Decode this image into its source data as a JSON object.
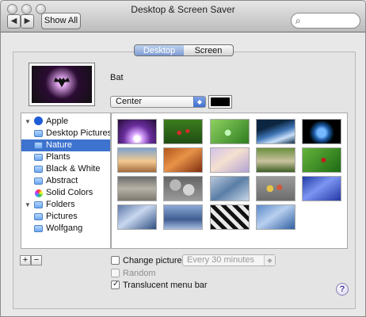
{
  "window": {
    "title": "Desktop & Screen Saver"
  },
  "toolbar": {
    "show_all_label": "Show All",
    "back_glyph": "◀",
    "forward_glyph": "▶",
    "search_placeholder": ""
  },
  "tabs": [
    {
      "label": "Desktop",
      "selected": true
    },
    {
      "label": "Screen Saver",
      "selected": false
    }
  ],
  "preview": {
    "wallpaper_name": "Bat"
  },
  "position_select": {
    "value": "Center"
  },
  "sidebar": {
    "items": [
      {
        "label": "Apple",
        "type": "group",
        "expanded": true
      },
      {
        "label": "Desktop Pictures",
        "type": "folder"
      },
      {
        "label": "Nature",
        "type": "folder",
        "selected": true
      },
      {
        "label": "Plants",
        "type": "folder"
      },
      {
        "label": "Black & White",
        "type": "folder"
      },
      {
        "label": "Abstract",
        "type": "folder"
      },
      {
        "label": "Solid Colors",
        "type": "solid"
      },
      {
        "label": "Folders",
        "type": "group",
        "expanded": true
      },
      {
        "label": "Pictures",
        "type": "folder"
      },
      {
        "label": "Wolfgang",
        "type": "folder"
      }
    ]
  },
  "thumbnails": [
    {
      "name": "purple-burst",
      "bg": "radial-gradient(circle at 50% 80%, #fff 0 10%, #d9a6ff 20%, #6a2e9d 50%, #220c35 100%)"
    },
    {
      "name": "ladybugs",
      "bg": "radial-gradient(circle at 40% 55%, #d52b2b 0 8%, transparent 9%), radial-gradient(circle at 62% 48%, #d52b2b 0 7%, transparent 8%), linear-gradient(#3d7d1f, #1f4d12)"
    },
    {
      "name": "dew-drop",
      "bg": "radial-gradient(circle at 45% 55%, #bff8b7 0 12%, transparent 13%), linear-gradient(135deg, #8ed160, #2f7d21)"
    },
    {
      "name": "wave-blue",
      "bg": "linear-gradient(160deg, #0c2540 0 30%, #3f75b5 55%, #c8dff8 75%, #0e2b49 100%)"
    },
    {
      "name": "earth",
      "bg": "radial-gradient(circle at 50% 55%, #75b8ff 0 18%, #1f5ca8 32%, #082846 45%, #000 55%)"
    },
    {
      "name": "sunset-clouds",
      "bg": "linear-gradient(#7da3d1, #f3c98f 55%, #a16b3d)"
    },
    {
      "name": "orange-dunes",
      "bg": "linear-gradient(145deg, #b4551d, #e89348 45%, #7e2d10)"
    },
    {
      "name": "pastel-sand",
      "bg": "linear-gradient(145deg, #d2c1e9, #f5e0d0 45%, #b4a3d5)"
    },
    {
      "name": "lake-trees",
      "bg": "linear-gradient(#6a8f3d, #c9c39f 55%, #3e5f24)"
    },
    {
      "name": "ladybug-leaf",
      "bg": "radial-gradient(circle at 55% 50%, #c31a1a 0 9%, transparent 10%), linear-gradient(135deg, #64b33b, #1d6b13)"
    },
    {
      "name": "zen-sand",
      "bg": "linear-gradient(#6c6c6c, #b6b2a6 50%, #7d786e)"
    },
    {
      "name": "pebbles",
      "bg": "radial-gradient(circle at 30% 35%, #b7b7b7 0 18%, transparent 19%), radial-gradient(circle at 65% 55%, #d5d5d5 0 20%, transparent 21%), linear-gradient(#646464, #9a9a9a)"
    },
    {
      "name": "water-ripple",
      "bg": "linear-gradient(145deg, #b8c8dc, #5a7ea6 50%, #c7d7e8)"
    },
    {
      "name": "colored-stones",
      "bg": "radial-gradient(circle at 35% 50%, #e6c44a 0 12%, transparent 13%), radial-gradient(circle at 60% 45%, #d1583a 0 10%, transparent 11%), linear-gradient(#9b9b9b, #6b6b6b)"
    },
    {
      "name": "blue-silk",
      "bg": "linear-gradient(145deg, #1f3aa5, #7c95f2 45%, #2438a6)"
    },
    {
      "name": "blue-ice",
      "bg": "linear-gradient(145deg, #5f79a9, #c8d7ef 45%, #2f4f81)"
    },
    {
      "name": "blue-water",
      "bg": "linear-gradient(#8ca9d6, #3f5d91 60%, #a8bfe3)"
    },
    {
      "name": "zebra",
      "bg": "repeating-linear-gradient(45deg, #111 0 5px, #e8e8e8 5px 10px)"
    },
    {
      "name": "blue-ripples",
      "bg": "linear-gradient(145deg, #5a87c9, #b8d0ef 45%, #2f5fa2)"
    }
  ],
  "controls": {
    "change_picture_label": "Change picture:",
    "change_picture_checked": false,
    "interval_value": "Every 30 minutes",
    "random_label": "Random",
    "random_checked": false,
    "translucent_label": "Translucent menu bar",
    "translucent_checked": true
  },
  "help": {
    "glyph": "?"
  }
}
